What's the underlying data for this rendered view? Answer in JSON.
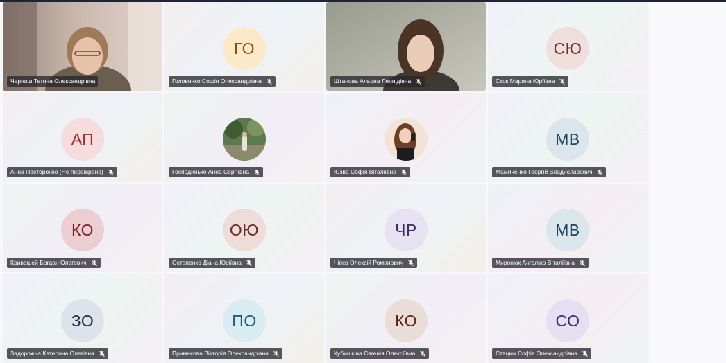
{
  "participants": [
    {
      "name": "Черниш Тетяна Олександрівна",
      "type": "video",
      "muted": false
    },
    {
      "name": "Головянко Софія Олександрівна",
      "initials": "ГО",
      "avatar_bg": "#fbe9c7",
      "avatar_fg": "#8a4f0b",
      "muted": true
    },
    {
      "name": "Штанова Альона Леонідівна",
      "type": "video",
      "muted": true
    },
    {
      "name": "Скок Марина Юріївна",
      "initials": "СЮ",
      "avatar_bg": "#efdfdc",
      "avatar_fg": "#6b2f2a",
      "muted": true
    },
    {
      "name": "Анна Посторонко (Не перевірено)",
      "initials": "АП",
      "avatar_bg": "#f6dcdc",
      "avatar_fg": "#9c2a2a",
      "muted": true
    },
    {
      "name": "Господинько Анна Сергіївна",
      "type": "photo",
      "muted": true
    },
    {
      "name": "Юзва Софія Віталіївна",
      "type": "photo",
      "muted": true
    },
    {
      "name": "Мамиченко Георгій Владиславович",
      "initials": "МВ",
      "avatar_bg": "#dbe5ec",
      "avatar_fg": "#23445a",
      "muted": true
    },
    {
      "name": "Кривошей Богдан Олегович",
      "initials": "КО",
      "avatar_bg": "#ebcdd2",
      "avatar_fg": "#7e1c2b",
      "muted": true
    },
    {
      "name": "Остапенко Діана Юріївна",
      "initials": "ОЮ",
      "avatar_bg": "#eddcd7",
      "avatar_fg": "#6e2a20",
      "muted": true
    },
    {
      "name": "Чіпко Олексій Романович",
      "initials": "ЧР",
      "avatar_bg": "#e6e2f2",
      "avatar_fg": "#3b2d66",
      "muted": true
    },
    {
      "name": "Миронюк Ангеліна Віталіївна",
      "initials": "МВ",
      "avatar_bg": "#dbe5ec",
      "avatar_fg": "#23445a",
      "muted": true
    },
    {
      "name": "Задорожна Катерина Олегівна",
      "initials": "ЗО",
      "avatar_bg": "#dde3ea",
      "avatar_fg": "#1f2f40",
      "muted": true
    },
    {
      "name": "Примакова Вікторія Олександрівна",
      "initials": "ПО",
      "avatar_bg": "#d9ecf2",
      "avatar_fg": "#1b5c78",
      "muted": true
    },
    {
      "name": "Кубишкіна Євгенія Олексіївна",
      "initials": "КО",
      "avatar_bg": "#eadcd6",
      "avatar_fg": "#5e2616",
      "muted": true
    },
    {
      "name": "Стецюк Софія Олександрівна",
      "initials": "СО",
      "avatar_bg": "#e4e0f2",
      "avatar_fg": "#3a2c68",
      "muted": true
    }
  ]
}
